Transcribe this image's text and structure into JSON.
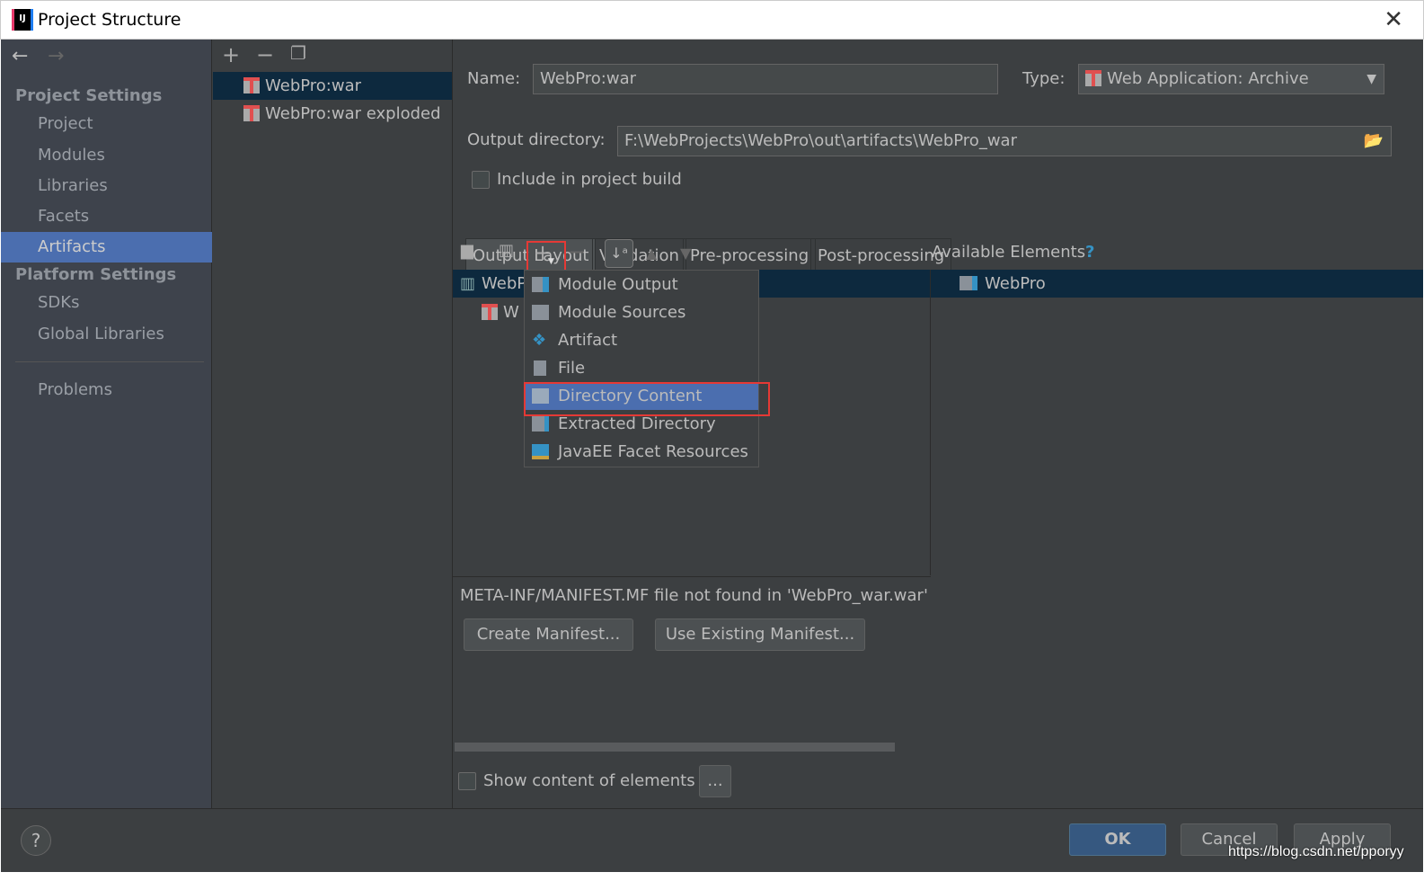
{
  "window": {
    "title": "Project Structure",
    "close_icon": "close-icon"
  },
  "sidebar": {
    "project_settings": "Project Settings",
    "items": [
      {
        "label": "Project"
      },
      {
        "label": "Modules"
      },
      {
        "label": "Libraries"
      },
      {
        "label": "Facets"
      },
      {
        "label": "Artifacts",
        "selected": true
      }
    ],
    "platform_settings": "Platform Settings",
    "platform_items": [
      {
        "label": "SDKs"
      },
      {
        "label": "Global Libraries"
      }
    ],
    "problems": "Problems"
  },
  "artifacts": [
    {
      "label": "WebPro:war",
      "selected": true
    },
    {
      "label": "WebPro:war exploded"
    }
  ],
  "form": {
    "name_label": "Name:",
    "name_value": "WebPro:war",
    "type_label": "Type:",
    "type_value": "Web Application: Archive",
    "output_label": "Output directory:",
    "output_value": "F:\\WebProjects\\WebPro\\out\\artifacts\\WebPro_war",
    "include_label": "Include in project build",
    "include_checked": false
  },
  "tabs": [
    {
      "label": "Output Layout",
      "selected": true
    },
    {
      "label": "Validation"
    },
    {
      "label": "Pre-processing"
    },
    {
      "label": "Post-processing"
    }
  ],
  "layout": {
    "available_label": "Available Elements",
    "help": "?",
    "tree": [
      {
        "label": "WebPro_war.war"
      },
      {
        "label": "WebPro:war exploded"
      }
    ],
    "tree_visible": [
      "WebP",
      "W"
    ],
    "available_items": [
      {
        "label": "WebPro"
      }
    ]
  },
  "menu": {
    "items": [
      {
        "label": "Module Output"
      },
      {
        "label": "Module Sources"
      },
      {
        "label": "Artifact"
      },
      {
        "label": "File"
      },
      {
        "label": "Directory Content",
        "selected": true
      },
      {
        "label": "Extracted Directory"
      },
      {
        "label": "JavaEE Facet Resources"
      }
    ]
  },
  "manifest": {
    "message": "META-INF/MANIFEST.MF file not found in 'WebPro_war.war'",
    "create": "Create Manifest...",
    "use_existing": "Use Existing Manifest..."
  },
  "show_content": {
    "label": "Show content of elements",
    "checked": false,
    "more": "..."
  },
  "footer": {
    "help": "?",
    "ok": "OK",
    "cancel": "Cancel",
    "apply": "Apply",
    "watermark": "https://blog.csdn.net/pporyy"
  },
  "colors": {
    "accent": "#4b6eaf",
    "highlight": "#e53935",
    "background": "#3c3f41"
  }
}
